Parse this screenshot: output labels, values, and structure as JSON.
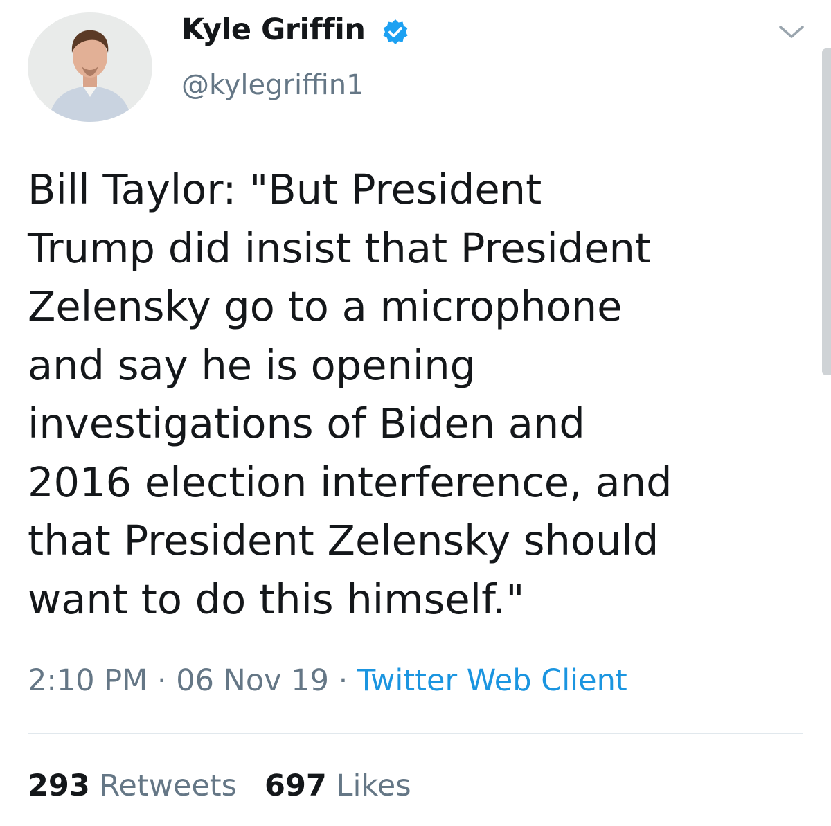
{
  "user": {
    "display_name": "Kyle Griffin",
    "handle": "@kylegriffin1"
  },
  "icons": {
    "verified": "verified-badge-icon",
    "more": "chevron-down-icon"
  },
  "colors": {
    "verified_blue": "#1da1f2",
    "link_blue": "#1b95e0",
    "secondary_text": "#657786"
  },
  "tweet": {
    "lines": [
      "Bill Taylor: \"But President",
      "Trump did insist that President",
      "Zelensky go to a microphone",
      "and say he is opening",
      "investigations of Biden and",
      "2016 election interference, and",
      "that President Zelensky should",
      "want to do this himself.\""
    ]
  },
  "meta": {
    "time": "2:10 PM",
    "separator": " · ",
    "date": "06 Nov 19",
    "source": "Twitter Web Client"
  },
  "stats": {
    "retweets_count": "293",
    "retweets_label": "Retweets",
    "likes_count": "697",
    "likes_label": "Likes"
  }
}
